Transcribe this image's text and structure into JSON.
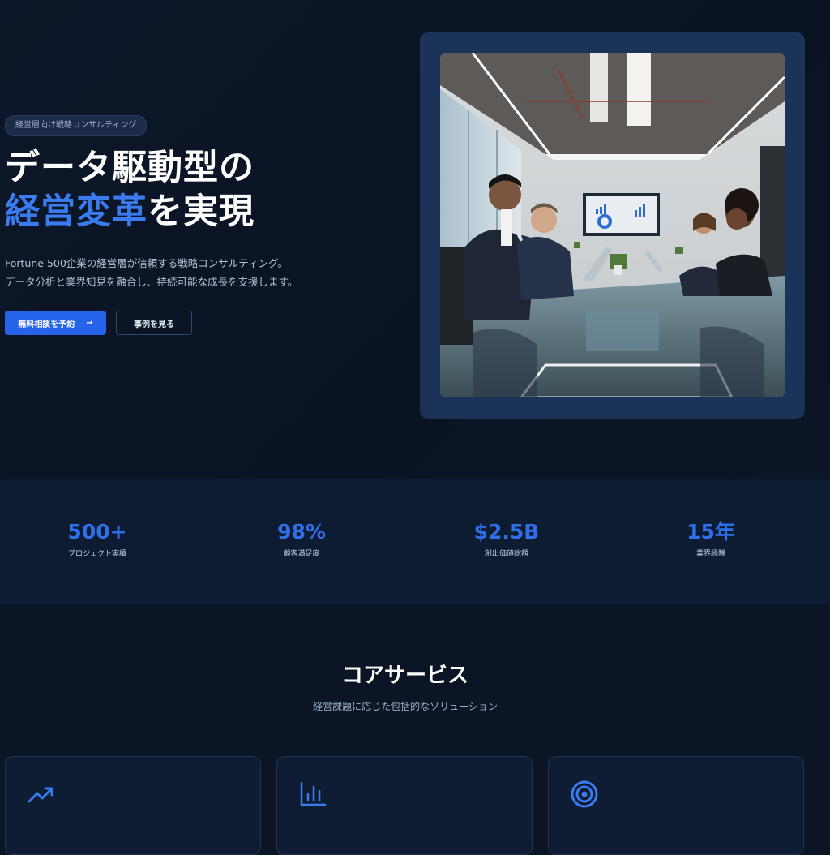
{
  "hero": {
    "badge": "経営層向け戦略コンサルティング",
    "title_line1": "データ駆動型の",
    "title_accent": "経営変革",
    "title_line2_rest": "を実現",
    "description_line1": "Fortune 500企業の経営層が信頼する戦略コンサルティング。",
    "description_line2": "データ分析と業界知見を融合し、持続可能な成長を支援します。",
    "primary_button": "無料相談を予約",
    "primary_button_arrow": "→",
    "secondary_button": "事例を見る"
  },
  "stats": [
    {
      "value": "500+",
      "label": "プロジェクト実績"
    },
    {
      "value": "98%",
      "label": "顧客満足度"
    },
    {
      "value": "$2.5B",
      "label": "創出価値総額"
    },
    {
      "value": "15年",
      "label": "業界経験"
    }
  ],
  "services": {
    "title": "コアサービス",
    "subtitle": "経営課題に応じた包括的なソリューション",
    "cards": [
      {
        "icon": "trending-up-icon"
      },
      {
        "icon": "bar-chart-icon"
      },
      {
        "icon": "target-icon"
      }
    ]
  },
  "colors": {
    "background": "#0b1526",
    "accent": "#2563eb",
    "stat_value": "#2f6fe8",
    "frame": "#1b3358"
  }
}
